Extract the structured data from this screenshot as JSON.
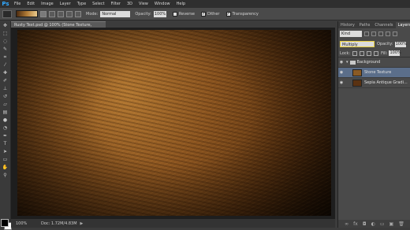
{
  "app": {
    "logo": "Ps"
  },
  "menu": [
    "File",
    "Edit",
    "Image",
    "Layer",
    "Type",
    "Select",
    "Filter",
    "3D",
    "View",
    "Window",
    "Help"
  ],
  "options": {
    "mode_label": "Mode:",
    "mode_value": "Normal",
    "opacity_label": "Opacity:",
    "opacity_value": "100%",
    "reverse_label": "Reverse",
    "dither_label": "Dither",
    "transparency_label": "Transparency"
  },
  "document": {
    "tab_title": "Rusty Text.psd @ 100% (Stone Texture, RGB/8) *",
    "zoom": "100%",
    "doc_info": "Doc: 1.72M/4.83M"
  },
  "panel": {
    "tabs": [
      "History",
      "Paths",
      "Channels",
      "Layers"
    ],
    "active_tab": "Layers",
    "kind": "Kind",
    "blend_mode": "Multiply",
    "opacity_label": "Opacity:",
    "opacity_value": "100%",
    "lock_label": "Lock:",
    "fill_label": "Fill:",
    "fill_value": "100%",
    "layers": [
      {
        "name": "Background",
        "type": "group",
        "selected": false
      },
      {
        "name": "Stone Texture",
        "type": "layer",
        "selected": true,
        "thumb": "#8a5a25"
      },
      {
        "name": "Sepia Antique Gradi...",
        "type": "layer",
        "selected": false,
        "thumb": "#5a3212"
      }
    ]
  },
  "colors": {
    "accent": "#31a8ff",
    "selection": "#5b6e8a",
    "highlight": "#e8d040"
  },
  "icons": [
    "move-icon",
    "marquee-icon",
    "lasso-icon",
    "quick-select-icon",
    "crop-icon",
    "eyedropper-icon",
    "healing-icon",
    "brush-icon",
    "stamp-icon",
    "history-brush-icon",
    "eraser-icon",
    "gradient-icon",
    "blur-icon",
    "dodge-icon",
    "pen-icon",
    "type-icon",
    "path-select-icon",
    "shape-icon",
    "hand-icon",
    "zoom-icon"
  ]
}
